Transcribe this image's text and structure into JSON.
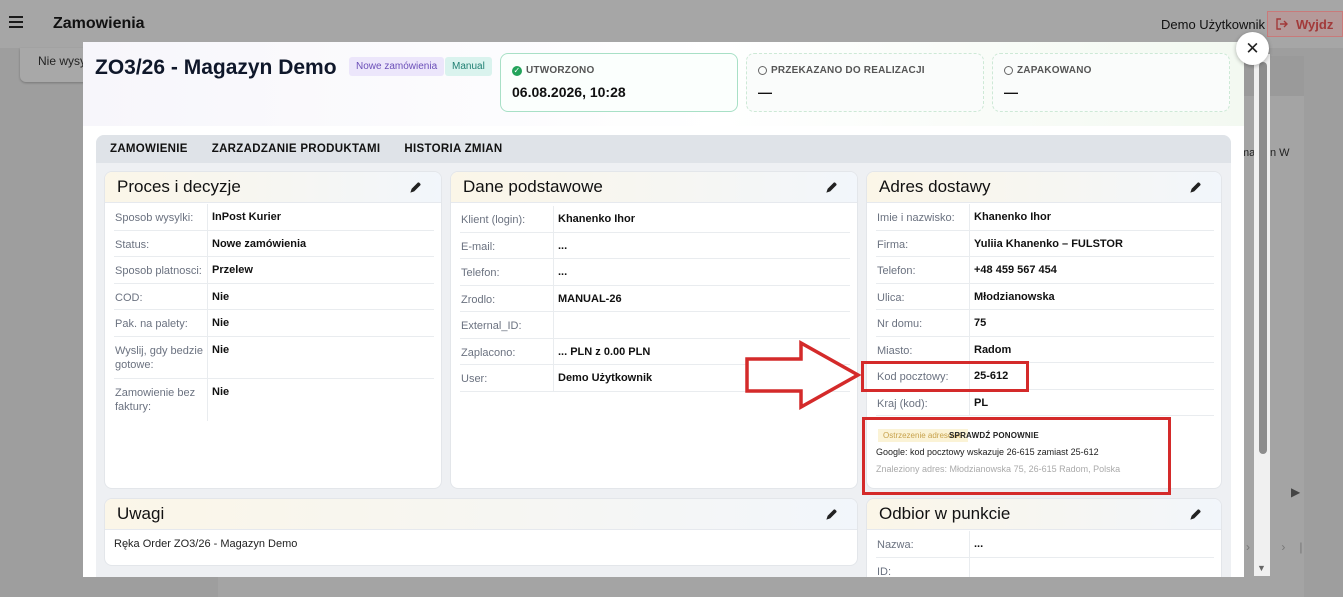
{
  "app": {
    "title": "Zamowienia",
    "user": "Demo Użytkownik",
    "logout_label": "Wyjdz",
    "bg_tab_text": "Nie wysy",
    "bg_side_text": "ma d in W"
  },
  "modal": {
    "order_title": "ZO3/26 - Magazyn Demo",
    "badges": [
      "Nowe zamówienia",
      "Manual"
    ],
    "stages": [
      {
        "label": "UTWORZONO",
        "value": "06.08.2026, 10:28",
        "done": true
      },
      {
        "label": "PRZEKAZANO DO REALIZACJI",
        "value": "—",
        "done": false
      },
      {
        "label": "ZAPAKOWANO",
        "value": "—",
        "done": false
      }
    ],
    "tabs": [
      "ZAMOWIENIE",
      "ZARZADZANIE PRODUKTAMI",
      "HISTORIA ZMIAN"
    ]
  },
  "process": {
    "title": "Proces i decyzje",
    "rows": [
      {
        "k": "Sposob wysylki:",
        "v": "InPost Kurier"
      },
      {
        "k": "Status:",
        "v": "Nowe zamówienia"
      },
      {
        "k": "Sposob platnosci:",
        "v": "Przelew"
      },
      {
        "k": "COD:",
        "v": "Nie"
      },
      {
        "k": "Pak. na palety:",
        "v": "Nie"
      },
      {
        "k": "Wyslij, gdy bedzie gotowe:",
        "v": "Nie"
      },
      {
        "k": "Zamowienie bez faktury:",
        "v": "Nie"
      }
    ]
  },
  "basic": {
    "title": "Dane podstawowe",
    "rows": [
      {
        "k": "Klient (login):",
        "v": "Khanenko Ihor"
      },
      {
        "k": "E-mail:",
        "v": "..."
      },
      {
        "k": "Telefon:",
        "v": "..."
      },
      {
        "k": "Zrodlo:",
        "v": "MANUAL-26"
      },
      {
        "k": "External_ID:",
        "v": ""
      },
      {
        "k": "Zaplacono:",
        "v": "... PLN z 0.00 PLN"
      },
      {
        "k": "User:",
        "v": "Demo Użytkownik"
      }
    ]
  },
  "address": {
    "title": "Adres dostawy",
    "rows": [
      {
        "k": "Imie i nazwisko:",
        "v": "Khanenko Ihor"
      },
      {
        "k": "Firma:",
        "v": "Yuliia Khanenko – FULSTOR"
      },
      {
        "k": "Telefon:",
        "v": "+48 459 567 454"
      },
      {
        "k": "Ulica:",
        "v": "Młodzianowska"
      },
      {
        "k": "Nr domu:",
        "v": "75"
      },
      {
        "k": "Miasto:",
        "v": "Radom"
      },
      {
        "k": "Kod pocztowy:",
        "v": "25-612"
      },
      {
        "k": "Kraj (kod):",
        "v": "PL"
      }
    ],
    "warning": {
      "badge": "Ostrzezenie adresowe",
      "recheck_label": "SPRAWDŹ PONOWNIE",
      "message": "Google: kod pocztowy wskazuje 26-615 zamiast 25-612",
      "found": "Znaleziony adres: Młodzianowska 75, 26-615 Radom, Polska"
    }
  },
  "notes": {
    "title": "Uwagi",
    "text": "Ręka Order ZO3/26 - Magazyn Demo"
  },
  "pickup": {
    "title": "Odbior w punkcie",
    "rows": [
      {
        "k": "Nazwa:",
        "v": "..."
      },
      {
        "k": "ID:",
        "v": ""
      }
    ]
  },
  "colors": {
    "highlight": "#d42a2a",
    "accent_green": "#22a35a"
  }
}
